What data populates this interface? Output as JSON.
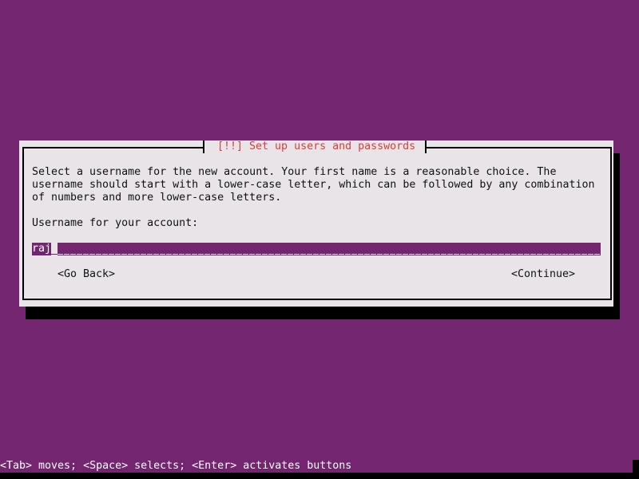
{
  "dialog": {
    "title": "[!!] Set up users and passwords",
    "description_lines": [
      "Select a username for the new account. Your first name is a reasonable choice. The",
      "username should start with a lower-case letter, which can be followed by any combination",
      "of numbers and more lower-case letters."
    ],
    "field_label": "Username for your account:",
    "username_value": "raj",
    "go_back_label": "<Go Back>",
    "continue_label": "<Continue>"
  },
  "statusbar": {
    "hint": "<Tab> moves; <Space> selects; <Enter> activates buttons"
  },
  "colors": {
    "background": "#742570",
    "dialog_bg": "#e8e4e8",
    "title": "#e03a3a",
    "shadow": "#000000"
  }
}
